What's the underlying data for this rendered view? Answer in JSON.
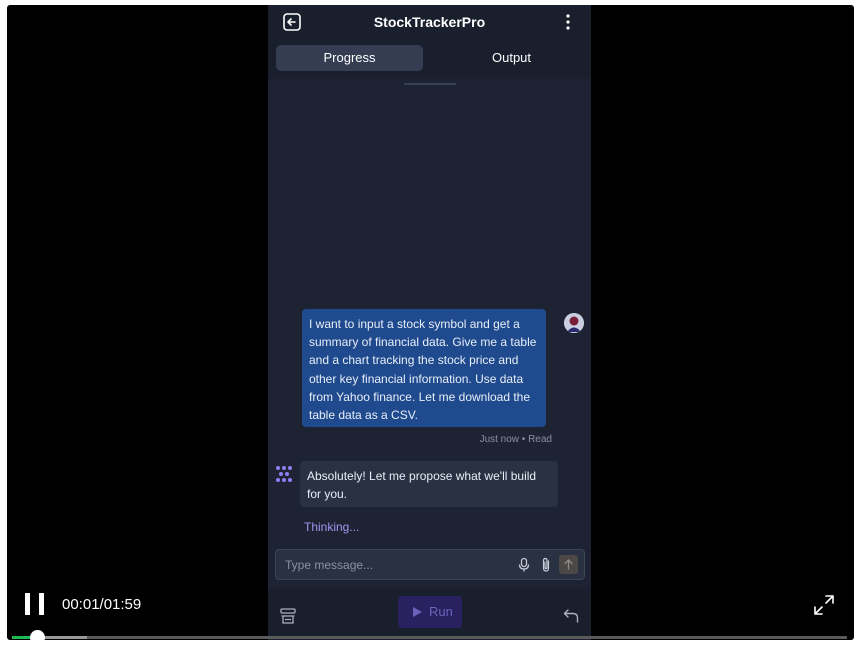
{
  "app": {
    "title": "StockTrackerPro"
  },
  "tabs": [
    {
      "label": "Progress",
      "active": true
    },
    {
      "label": "Output",
      "active": false
    }
  ],
  "chat": {
    "user_message": "I want to input a stock symbol and get a summary of financial data. Give me a table and a chart tracking the stock price and other key financial information. Use data from Yahoo finance. Let me download the table data as a CSV.",
    "user_meta": "Just now • Read",
    "assistant_message": "Absolutely! Let me propose what we'll build for you.",
    "status": "Thinking..."
  },
  "composer": {
    "placeholder": "Type message..."
  },
  "toolbar": {
    "run_label": "Run"
  },
  "player": {
    "time": "00:01/01:59",
    "progress_fraction": 0.03,
    "buffered_fraction": 0.09
  },
  "colors": {
    "accent": "#9d96f0",
    "user_bubble": "#1f4b8e",
    "progress_played": "#1db954"
  },
  "icons": {
    "exit": "exit-icon",
    "menu": "kebab-menu-icon",
    "avatar": "user-avatar",
    "assistant": "assistant-logo-icon",
    "mic": "mic-icon",
    "attach": "paperclip-icon",
    "send": "send-arrow-icon",
    "pages": "pages-icon",
    "run": "play-icon",
    "undo": "undo-icon",
    "pause": "pause-icon",
    "fullscreen": "fullscreen-icon"
  }
}
